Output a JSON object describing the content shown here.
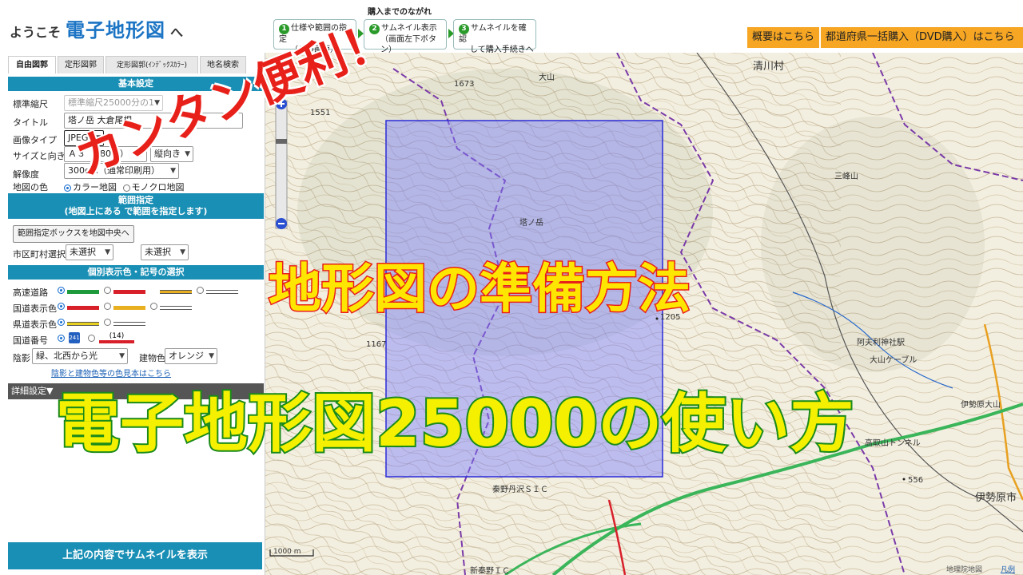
{
  "header": {
    "welcome_prefix": "ようこそ",
    "brand": "電子地形図",
    "welcome_suffix": "へ",
    "flow_title": "購入までのながれ",
    "steps": [
      {
        "num": "1",
        "line1": "仕様や範囲の指定",
        "line2": "（この画面）"
      },
      {
        "num": "2",
        "line1": "サムネイル表示",
        "line2": "（画面左下ボタン）"
      },
      {
        "num": "3",
        "line1": "サムネイルを確認",
        "line2": "して購入手続きへ"
      }
    ],
    "overview_button": "概要はこちら",
    "bulk_button": "都道府県一括購入（DVD購入）はこちら"
  },
  "sidebar": {
    "tabs": [
      "自由図郭",
      "定形図郭",
      "定形図郭(ｲﾝﾃﾞｯｸｽｶﾗｰ)",
      "地名検索"
    ],
    "basic_settings": {
      "heading": "基本設定",
      "scale_label": "標準縮尺",
      "scale_value": "標準縮尺25000分の1",
      "title_label": "タイトル",
      "title_value": "塔ノ岳 大倉尾根",
      "image_type_label": "画像タイプ",
      "image_type_value": "JPEG",
      "size_label": "サイズと向き",
      "size_value": "Ａ３（280円）",
      "orientation_value": "縦向き",
      "resolution_label": "解像度",
      "resolution_value": "300dpi（通常印刷用）",
      "color_label": "地図の色",
      "color_option_1": "カラー地図",
      "color_option_2": "モノクロ地図"
    },
    "range": {
      "heading_line1": "範囲指定",
      "heading_line2": "(地図上にある      で範囲を指定します)",
      "center_button": "範囲指定ボックスを地図中央へ",
      "city_label": "市区町村選択",
      "city_value_1": "未選択",
      "city_value_2": "未選択"
    },
    "symbols": {
      "heading": "個別表示色・記号の選択",
      "highway_label": "高速道路",
      "national_label": "国道表示色",
      "prefectural_label": "県道表示色",
      "route_number_label": "国道番号",
      "route_badge": "241",
      "route_sample": "(14)",
      "shade_label": "陰影",
      "shade_value": "緑、北西から光",
      "building_label": "建物色",
      "building_value": "オレンジ",
      "sample_link": "陰影と建物色等の色見本はこちら"
    },
    "detail_settings": "詳細設定▼",
    "submit_button": "上記の内容でサムネイルを表示",
    "colors": {
      "highway": [
        "#1e9a3c",
        "#d8202a"
      ],
      "national": [
        "#d8202a",
        "#e8b020"
      ],
      "prefectural": [
        "#e8d020"
      ]
    }
  },
  "map": {
    "labels": {
      "village": "清川村",
      "peak_oyama": "大山",
      "peak_mitsumine": "三峰山",
      "peak_tonodake": "塔ノ岳",
      "station": "阿夫利神社駅",
      "cable": "大山ケーブル",
      "city": "伊勢原市",
      "ic_hadano": "秦野丹沢ＳＩＣ",
      "ic_shin": "新秦野ＩＣ",
      "tunnel": "高取山トンネル",
      "isehara_oyama": "伊勢原大山",
      "elev_1205": "1205",
      "elev_1167": "1167",
      "elev_556": "556",
      "elev_1673": "1673",
      "elev_1551": "1551",
      "scale_bar": "1000 m",
      "credit": "地理院地図",
      "legend": "凡例"
    }
  },
  "overlay": {
    "caption_1": "カンタン便利！",
    "caption_2": "地形図の準備方法",
    "caption_3": "電子地形図25000の使い方"
  }
}
